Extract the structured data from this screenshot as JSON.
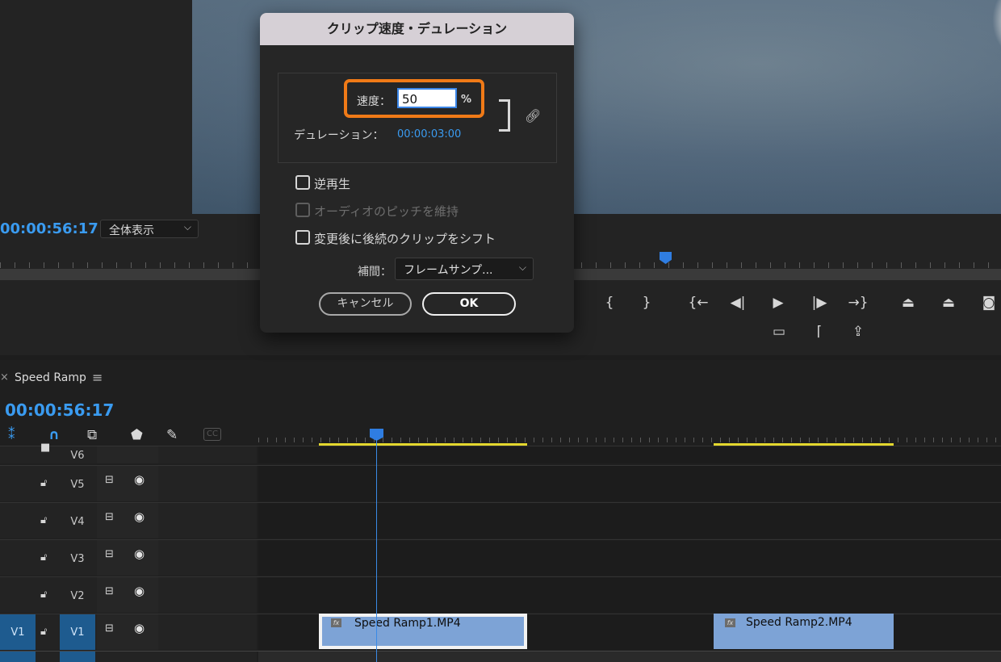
{
  "monitor": {
    "timecode": "00:00:56:17",
    "zoom_label": "全体表示",
    "controls": [
      "{",
      "}",
      "{←",
      "◀|",
      "▶",
      "|▶",
      "→}",
      "lift",
      "extract",
      "camera"
    ],
    "controls2": [
      "safe-margins",
      "compare",
      "export"
    ]
  },
  "dialog": {
    "title": "クリップ速度・デュレーション",
    "speed_label": "速度：",
    "speed_value": "50",
    "speed_unit": "%",
    "duration_label": "デュレーション：",
    "duration_value": "00:00:03:00",
    "reverse_label": "逆再生",
    "pitch_label": "オーディオのピッチを維持",
    "ripple_label": "変更後に後続のクリップをシフト",
    "interp_label": "補間：",
    "interp_value": "フレームサンプ...",
    "cancel_label": "キャンセル",
    "ok_label": "OK"
  },
  "timeline": {
    "close_glyph": "×",
    "title": "Speed Ramp",
    "menu_glyph": "≡",
    "timecode": "00:00:56:17",
    "cc_label": "CC",
    "tracks": [
      {
        "name": "V6"
      },
      {
        "name": "V5"
      },
      {
        "name": "V4"
      },
      {
        "name": "V3"
      },
      {
        "name": "V2"
      },
      {
        "name": "V1",
        "source": "V1"
      }
    ],
    "clips": [
      {
        "name": "Speed Ramp1.MP4",
        "fx": "fx"
      },
      {
        "name": "Speed Ramp2.MP4",
        "fx": "fx"
      }
    ]
  },
  "colors": {
    "accent_blue": "#3a9bf0",
    "highlight_orange": "#f07a17",
    "clip_blue": "#7da3d6",
    "work_area_yellow": "#e3d72e"
  }
}
